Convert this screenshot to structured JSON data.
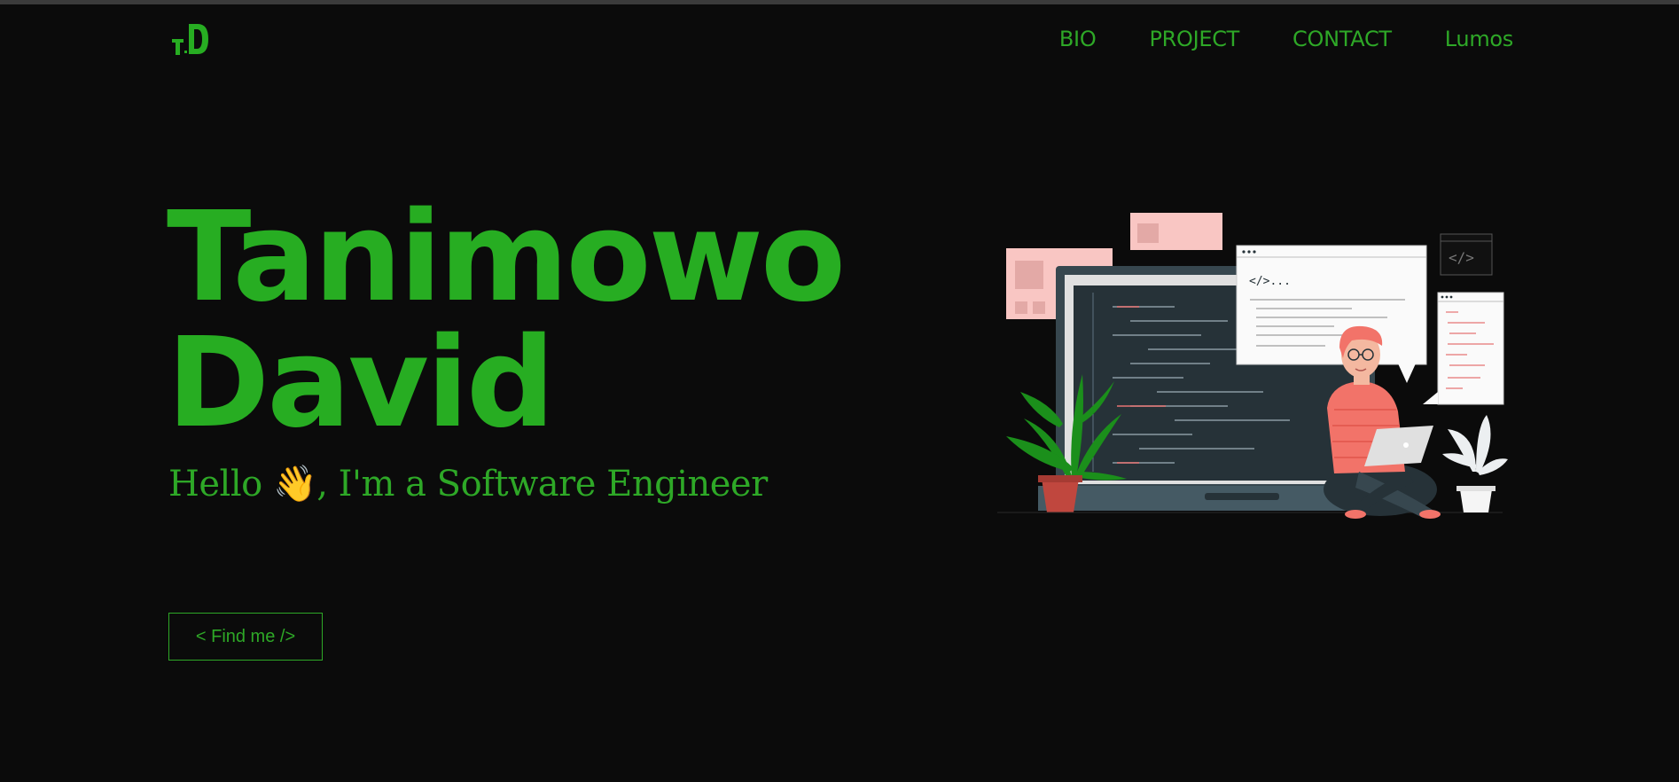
{
  "brand": {
    "logo_text": "TD"
  },
  "nav": {
    "items": [
      "BIO",
      "PROJECT",
      "CONTACT",
      "Lumos"
    ]
  },
  "hero": {
    "name_line1": "Tanimowo",
    "name_line2": "David",
    "greeting_prefix": "Hello ",
    "greeting_emoji": "👋",
    "greeting_suffix": ", I'm a Software Engineer",
    "cta_label": "< Find me />"
  },
  "illustration": {
    "code_snippet": "</>..."
  },
  "colors": {
    "accent": "#27ad22",
    "background": "#0b0b0b"
  }
}
